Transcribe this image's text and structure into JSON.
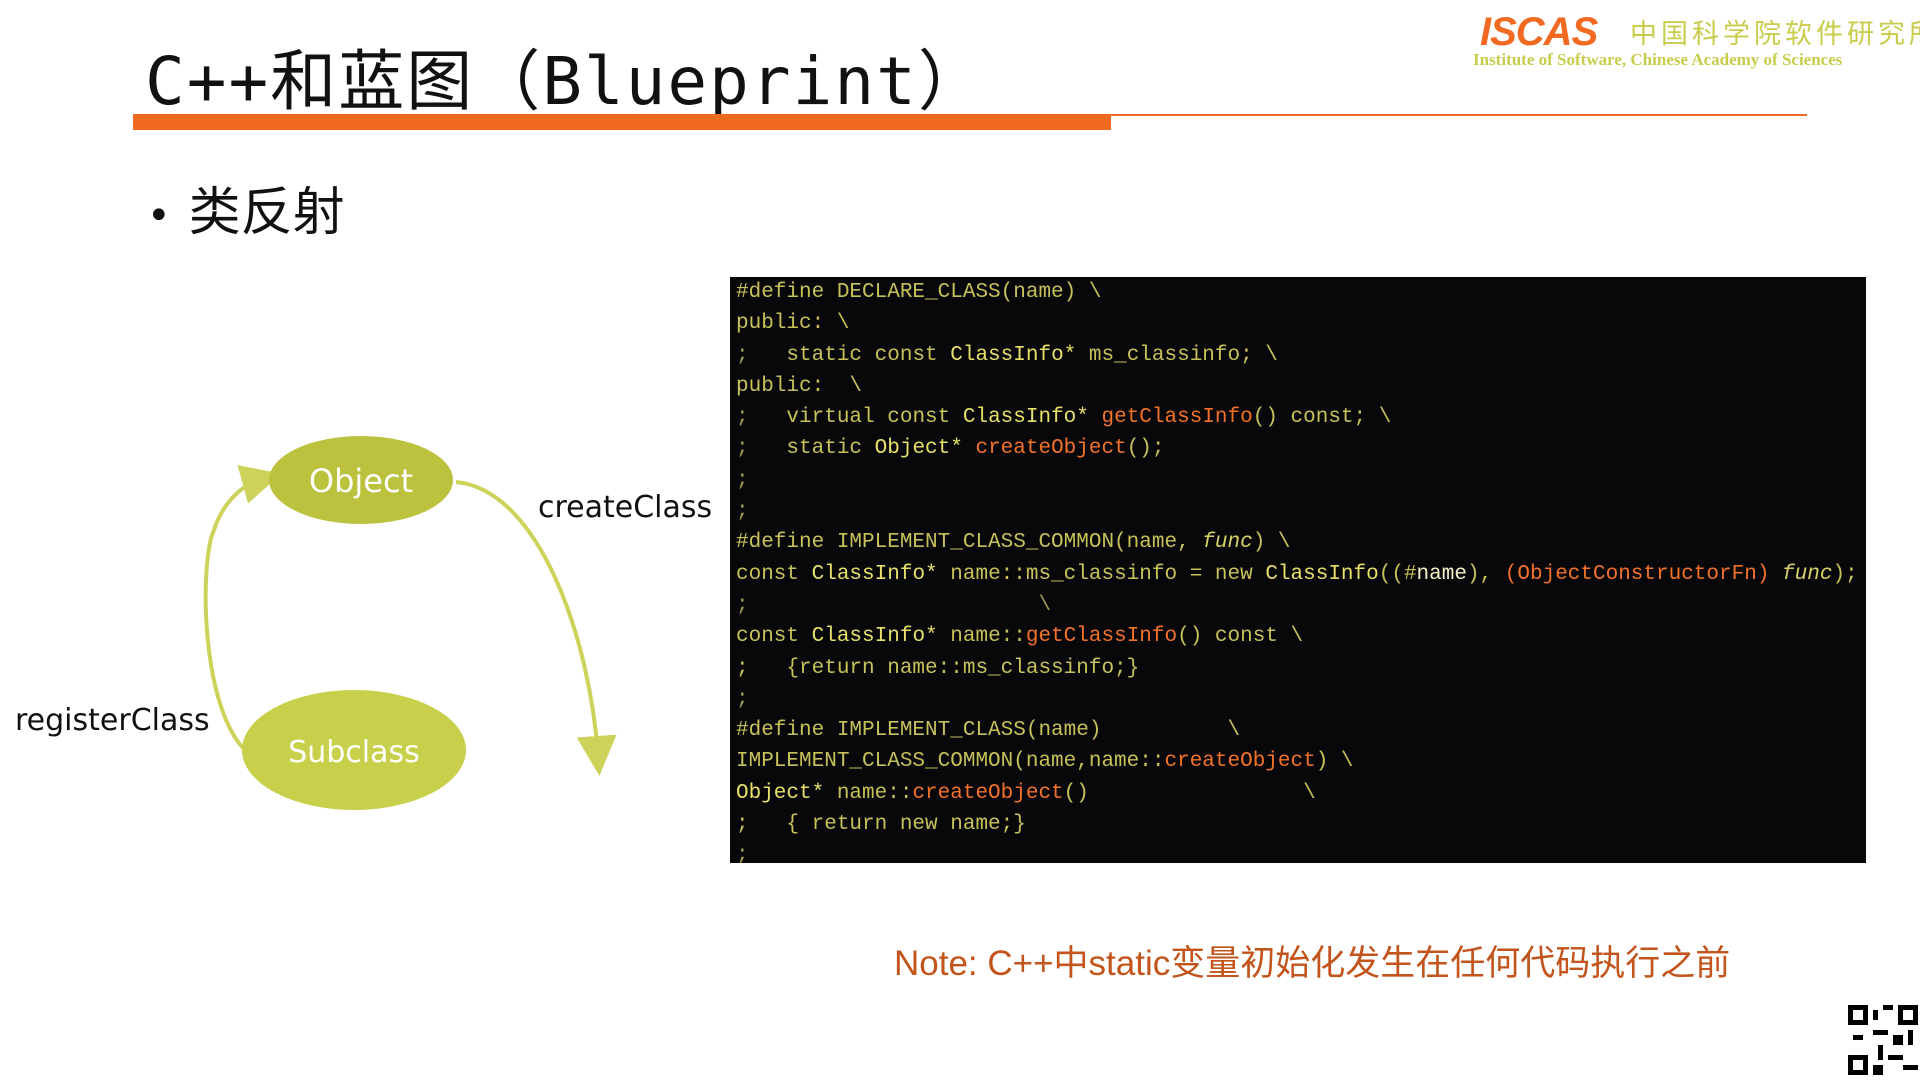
{
  "slide": {
    "title": "C++和蓝图（Blueprint）",
    "bullet": "类反射",
    "note": "Note:  C++中static变量初始化发生在任何代码执行之前"
  },
  "logo": {
    "mark": "ISCAS",
    "chinese": "中国科学院软件研究所",
    "english": "Institute of Software, Chinese Academy of Sciences"
  },
  "diagram": {
    "node_object": "Object",
    "node_subclass": "Subclass",
    "edge_create": "createClass",
    "edge_register": "registerClass",
    "colors": {
      "node": "#c8cf4a",
      "arrow": "#cdd35a"
    }
  },
  "code": {
    "lines": [
      [
        [
          "#define DECLARE_CLASS(name) \\",
          "k"
        ]
      ],
      [
        [
          "public: \\",
          "k"
        ]
      ],
      [
        [
          ";   ",
          "m"
        ],
        [
          "static const ",
          "k"
        ],
        [
          "ClassInfo*",
          "t"
        ],
        [
          " ms_classinfo; \\",
          "k"
        ]
      ],
      [
        [
          "public:  \\",
          "k"
        ]
      ],
      [
        [
          ";   ",
          "m"
        ],
        [
          "virtual const ",
          "k"
        ],
        [
          "ClassInfo*",
          "t"
        ],
        [
          " ",
          "k"
        ],
        [
          "getClassInfo",
          "f"
        ],
        [
          "() const; \\",
          "k"
        ]
      ],
      [
        [
          ";   ",
          "m"
        ],
        [
          "static ",
          "k"
        ],
        [
          "Object*",
          "t"
        ],
        [
          " ",
          "k"
        ],
        [
          "createObject",
          "f"
        ],
        [
          "();",
          "k"
        ]
      ],
      [
        [
          ";",
          "m"
        ]
      ],
      [
        [
          ";",
          "m"
        ]
      ],
      [
        [
          "#define IMPLEMENT_CLASS_COMMON(name, ",
          "k"
        ],
        [
          "func",
          "i"
        ],
        [
          ") \\",
          "k"
        ]
      ],
      [
        [
          "const ",
          "k"
        ],
        [
          "ClassInfo*",
          "t"
        ],
        [
          " name::ms_classinfo = new ",
          "k"
        ],
        [
          "ClassInfo",
          "t"
        ],
        [
          "((#",
          "k"
        ],
        [
          "name",
          "w"
        ],
        [
          "), ",
          "k"
        ],
        [
          "(ObjectConstructorFn)",
          "f"
        ],
        [
          " ",
          "k"
        ],
        [
          "func",
          "i"
        ],
        [
          ");",
          "k"
        ]
      ],
      [
        [
          ";                       \\",
          "m"
        ]
      ],
      [
        [
          "const ",
          "k"
        ],
        [
          "ClassInfo*",
          "t"
        ],
        [
          " name::",
          "k"
        ],
        [
          "getClassInfo",
          "f"
        ],
        [
          "() const \\",
          "k"
        ]
      ],
      [
        [
          ";   {return name::ms_classinfo;}",
          "k"
        ]
      ],
      [
        [
          ";",
          "m"
        ]
      ],
      [
        [
          "#define IMPLEMENT_CLASS(name)          \\",
          "k"
        ]
      ],
      [
        [
          "IMPLEMENT_CLASS_COMMON(name,name::",
          "k"
        ],
        [
          "createObject",
          "f"
        ],
        [
          ") \\",
          "k"
        ]
      ],
      [
        [
          "Object*",
          "t"
        ],
        [
          " name::",
          "k"
        ],
        [
          "createObject",
          "f"
        ],
        [
          "()                 \\",
          "k"
        ]
      ],
      [
        [
          ";   { return new name;}",
          "k"
        ]
      ],
      [
        [
          ";",
          "m"
        ]
      ]
    ]
  }
}
